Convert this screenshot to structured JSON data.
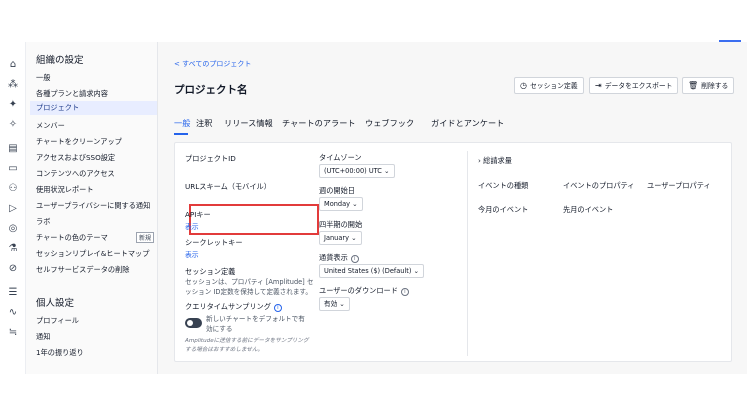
{
  "sidebar": {
    "org_title": "組織の設定",
    "org_items": [
      "一般",
      "各種プランと請求内容",
      "プロジェクト",
      "メンバー",
      "チャートをクリーンアップ",
      "アクセスおよびSSO設定",
      "コンテンツへのアクセス",
      "使用状況レポート",
      "ユーザープライバシーに関する通知",
      "ラボ",
      "チャートの色のテーマ",
      "セッションリプレイ&ヒートマップ",
      "セルフサービスデータの削除"
    ],
    "new_badge": "新規",
    "personal_title": "個人設定",
    "personal_items": [
      "プロフィール",
      "通知",
      "1年の振り返り"
    ]
  },
  "header": {
    "back_link": "< すべてのプロジェクト",
    "title": "プロジェクト名",
    "btn_session": "セッション定義",
    "btn_export": "データをエクスポート",
    "btn_delete": "削除する"
  },
  "tabs": [
    "一般",
    "注釈",
    "リリース情報",
    "チャートのアラート",
    "ウェブフック",
    "ガイドとアンケート"
  ],
  "card": {
    "project_id": "プロジェクトID",
    "url_scheme": "URLスキーム（モバイル）",
    "api_key": "APIキー",
    "api_show": "表示",
    "secret_key": "シークレットキー",
    "secret_show": "表示",
    "session_def": "セッション定義",
    "session_desc_1": "セッションは、プロパティ [Amplitude] セ",
    "session_desc_2": "ッション ID定数を保持して定義されます。",
    "sampling_label": "クエリタイムサンプリング",
    "sampling_toggle_1": "新しいチャートをデフォルトで有",
    "sampling_toggle_2": "効にする",
    "sampling_note_1": "Amplitudeに送信する前にデータをサンプリング",
    "sampling_note_2": "する場合はおすすめしません。",
    "timezone_label": "タイムゾーン",
    "timezone_value": "(UTC+00:00) UTC",
    "week_start_label": "週の開始日",
    "week_start_value": "Monday",
    "quarter_start_label": "四半期の開始",
    "quarter_start_value": "January",
    "currency_label": "通貨表示",
    "currency_value": "United States ($) (Default)",
    "download_label": "ユーザーのダウンロード",
    "download_value": "有効",
    "bill_toggle": "› 総請求量",
    "col_event_types": "イベントの種類",
    "col_event_props": "イベントのプロパティ",
    "col_user_props": "ユーザープロパティ",
    "this_month": "今月のイベント",
    "last_month": "先月のイベント"
  },
  "colors": {
    "accent": "#2563eb",
    "highlight": "#e23b3b"
  }
}
